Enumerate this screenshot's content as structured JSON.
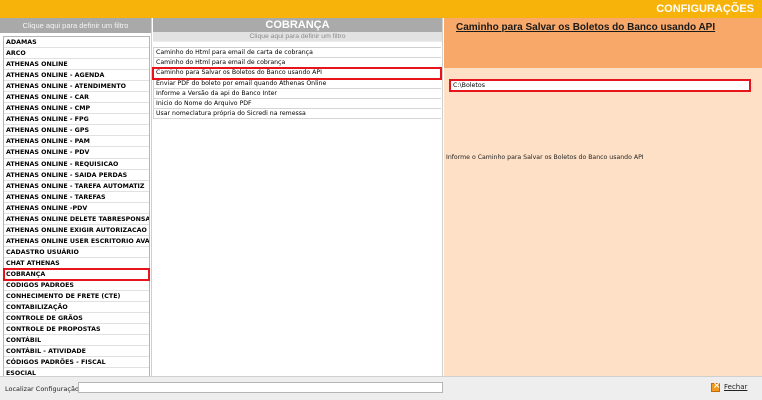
{
  "window": {
    "title": "CONFIGURAÇÕES"
  },
  "left_panel": {
    "filter_label": "Clique aqui para definir um filtro",
    "items": [
      "ADAMAS",
      "ARCO",
      "ATHENAS ONLINE",
      "ATHENAS ONLINE - AGENDA",
      "ATHENAS ONLINE - ATENDIMENTO",
      "ATHENAS ONLINE - CAR",
      "ATHENAS ONLINE - CMP",
      "ATHENAS ONLINE - FPG",
      "ATHENAS ONLINE - GPS",
      "ATHENAS ONLINE - PAM",
      "ATHENAS ONLINE - PDV",
      "ATHENAS ONLINE - REQUISICAO",
      "ATHENAS ONLINE - SAIDA PERDAS",
      "ATHENAS ONLINE - TAREFA AUTOMATIZ",
      "ATHENAS ONLINE - TAREFAS",
      "ATHENAS ONLINE -PDV",
      "ATHENAS ONLINE DELETE TABRESPONSA",
      "ATHENAS ONLINE EXIGIR AUTORIZACAO",
      "ATHENAS ONLINE USER ESCRITORIO AVA",
      "CADASTRO USUÁRIO",
      "CHAT ATHENAS",
      "COBRANÇA",
      "CODIGOS PADROES",
      "CONHECIMENTO DE FRETE (CTE)",
      "CONTABILIZAÇÃO",
      "CONTROLE DE GRÃOS",
      "CONTROLE DE PROPOSTAS",
      "CONTÁBIL",
      "CONTÁBIL - ATIVIDADE",
      "CÓDIGOS PADRÕES - FISCAL",
      "ESOCIAL"
    ],
    "selected_index": 21
  },
  "middle_panel": {
    "header": "COBRANÇA",
    "filter_label": "Clique aqui para definir um filtro",
    "items": [
      "Caminho do Html para email de carta de cobrança",
      "Caminho do Html para email de cobrança",
      "Caminho para Salvar os Boletos do Banco usando API",
      "Enviar PDF do boleto por email quando Athenas Online",
      "Informe a Versão da api do Banco Inter",
      "Inicio do Nome do Arquivo PDF",
      "Usar nomeclatura própria do Sicredi na remessa"
    ],
    "selected_index": 2
  },
  "right_panel": {
    "title": "Caminho para Salvar os Boletos do Banco usando API",
    "value": "C:\\Boletos",
    "description": "Informe o Caminho para Salvar os Boletos do Banco usando API"
  },
  "bottom_bar": {
    "search_label": "Localizar Configuração:",
    "search_value": "",
    "close_label": "Fechar"
  },
  "colors": {
    "title_bar": "#f7b30a",
    "header_orange": "#f8a969",
    "detail_bg": "#fde0c5",
    "selection": "#e8141b"
  }
}
